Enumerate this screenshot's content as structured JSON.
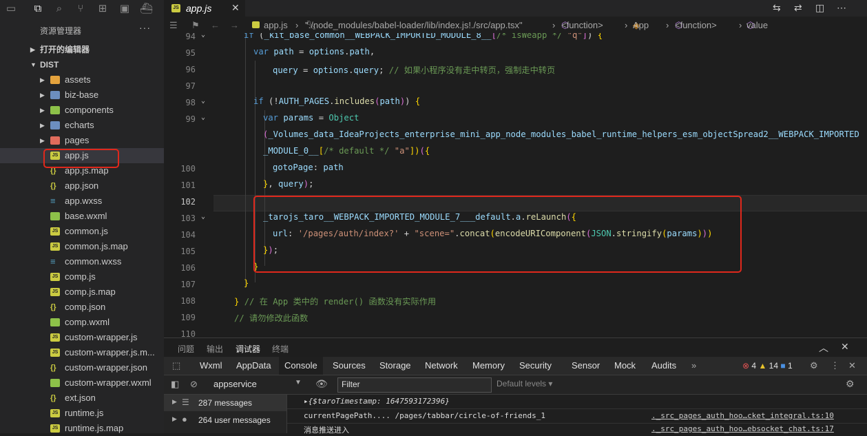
{
  "activity_bar": {
    "icons": [
      "explorer-icon",
      "search-icon",
      "source-control-icon",
      "extensions-icon",
      "remote-icon",
      "docker-icon"
    ]
  },
  "sidebar": {
    "title": "资源管理器",
    "more": "···",
    "open_editors": "打开的编辑器",
    "root": "DIST",
    "items": [
      {
        "name": "assets",
        "kind": "folder-orange"
      },
      {
        "name": "biz-base",
        "kind": "folder"
      },
      {
        "name": "components",
        "kind": "folder-green"
      },
      {
        "name": "echarts",
        "kind": "folder"
      },
      {
        "name": "pages",
        "kind": "folder-red"
      },
      {
        "name": "app.js",
        "kind": "js"
      },
      {
        "name": "app.js.map",
        "kind": "json"
      },
      {
        "name": "app.json",
        "kind": "json"
      },
      {
        "name": "app.wxss",
        "kind": "css"
      },
      {
        "name": "base.wxml",
        "kind": "wxml"
      },
      {
        "name": "common.js",
        "kind": "js"
      },
      {
        "name": "common.js.map",
        "kind": "js"
      },
      {
        "name": "common.wxss",
        "kind": "css"
      },
      {
        "name": "comp.js",
        "kind": "js"
      },
      {
        "name": "comp.js.map",
        "kind": "js"
      },
      {
        "name": "comp.json",
        "kind": "json"
      },
      {
        "name": "comp.wxml",
        "kind": "wxml"
      },
      {
        "name": "custom-wrapper.js",
        "kind": "js"
      },
      {
        "name": "custom-wrapper.js.m...",
        "kind": "js"
      },
      {
        "name": "custom-wrapper.json",
        "kind": "json"
      },
      {
        "name": "custom-wrapper.wxml",
        "kind": "wxml"
      },
      {
        "name": "ext.json",
        "kind": "json"
      },
      {
        "name": "runtime.js",
        "kind": "js"
      },
      {
        "name": "runtime.js.map",
        "kind": "js"
      }
    ]
  },
  "editor_tab": {
    "label": "app.js",
    "badge": "JS",
    "close": "✕"
  },
  "breadcrumb": {
    "file": "app.js",
    "path": "\"./node_modules/babel-loader/lib/index.js!./src/app.tsx\"",
    "fn1": "<function>",
    "cls": "App",
    "fn2": "<function>",
    "value": "value"
  },
  "code_lines": [
    {
      "n": "94",
      "text": "if (_kit_base_common__WEBPACK_IMPORTED_MODULE_8__[/* isWeapp */ \"q\"]) {"
    },
    {
      "n": "95",
      "text": "var path = options.path,"
    },
    {
      "n": "96",
      "text": "query = options.query; // 如果小程序没有走中转页，强制走中转页"
    },
    {
      "n": "97",
      "text": ""
    },
    {
      "n": "98",
      "text": "if (!AUTH_PAGES.includes(path)) {"
    },
    {
      "n": "99",
      "text": "var params = Object"
    },
    {
      "n": "",
      "text": "(_Volumes_data_IdeaProjects_enterprise_mini_app_node_modules_babel_runtime_helpers_esm_objectSpread2__WEBPACK_IMPORTED"
    },
    {
      "n": "",
      "text": "_MODULE_0__[/* default */ \"a\"])({"
    },
    {
      "n": "100",
      "text": "gotoPage: path"
    },
    {
      "n": "101",
      "text": "}, query);"
    },
    {
      "n": "102",
      "text": ""
    },
    {
      "n": "103",
      "text": "_tarojs_taro__WEBPACK_IMPORTED_MODULE_7___default.a.reLaunch({"
    },
    {
      "n": "104",
      "text": "url: '/pages/auth/index?' + \"scene=\".concat(encodeURIComponent(JSON.stringify(params)))"
    },
    {
      "n": "105",
      "text": "});"
    },
    {
      "n": "106",
      "text": "}"
    },
    {
      "n": "107",
      "text": "}"
    },
    {
      "n": "108",
      "text": "} // 在 App 类中的 render() 函数没有实际作用"
    },
    {
      "n": "109",
      "text": "// 请勿修改此函数"
    },
    {
      "n": "110",
      "text": ""
    }
  ],
  "panel": {
    "tabs": [
      "问题",
      "输出",
      "调试器",
      "终端"
    ],
    "active": "调试器"
  },
  "devtools": {
    "tabs": [
      "Wxml",
      "AppData",
      "Console",
      "Sources",
      "Storage",
      "Network",
      "Memory",
      "Security",
      "Sensor",
      "Mock",
      "Audits"
    ],
    "active": "Console",
    "more": "»",
    "errors": "4",
    "warnings": "14",
    "info": "1"
  },
  "console_bar": {
    "context": "appservice",
    "filter_placeholder": "Filter",
    "levels": "Default levels ▾"
  },
  "console_side": [
    {
      "label": "287 messages"
    },
    {
      "label": "264 user messages"
    }
  ],
  "logs": [
    {
      "text": "▸{$taroTimestamp: 1647593172396}",
      "src": ""
    },
    {
      "text": "currentPagePath.... /pages/tabbar/circle-of-friends_1",
      "src": "._src_pages_auth_hoo…cket_integral.ts:10"
    },
    {
      "text": "消息推送进入",
      "src": "._src_pages_auth_hoo…ebsocket_chat.ts:17"
    }
  ]
}
